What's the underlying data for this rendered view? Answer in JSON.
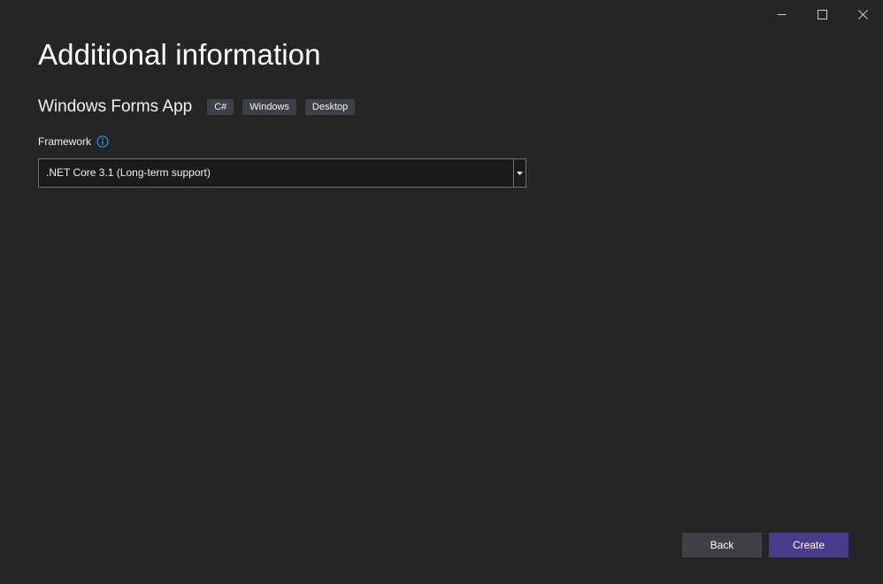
{
  "window_controls": {
    "minimize_icon": "minimize-icon",
    "maximize_icon": "maximize-icon",
    "close_icon": "close-icon"
  },
  "page": {
    "title": "Additional information"
  },
  "template": {
    "name": "Windows Forms App",
    "tags": [
      "C#",
      "Windows",
      "Desktop"
    ]
  },
  "framework": {
    "label": "Framework",
    "info_icon": "info-icon",
    "selected": ".NET Core 3.1 (Long-term support)"
  },
  "footer": {
    "back_label": "Back",
    "create_label": "Create"
  },
  "colors": {
    "background": "#252526",
    "accent": "#4b3b8a",
    "tag_background": "#3f3f46",
    "info_icon": "#3794d6"
  }
}
